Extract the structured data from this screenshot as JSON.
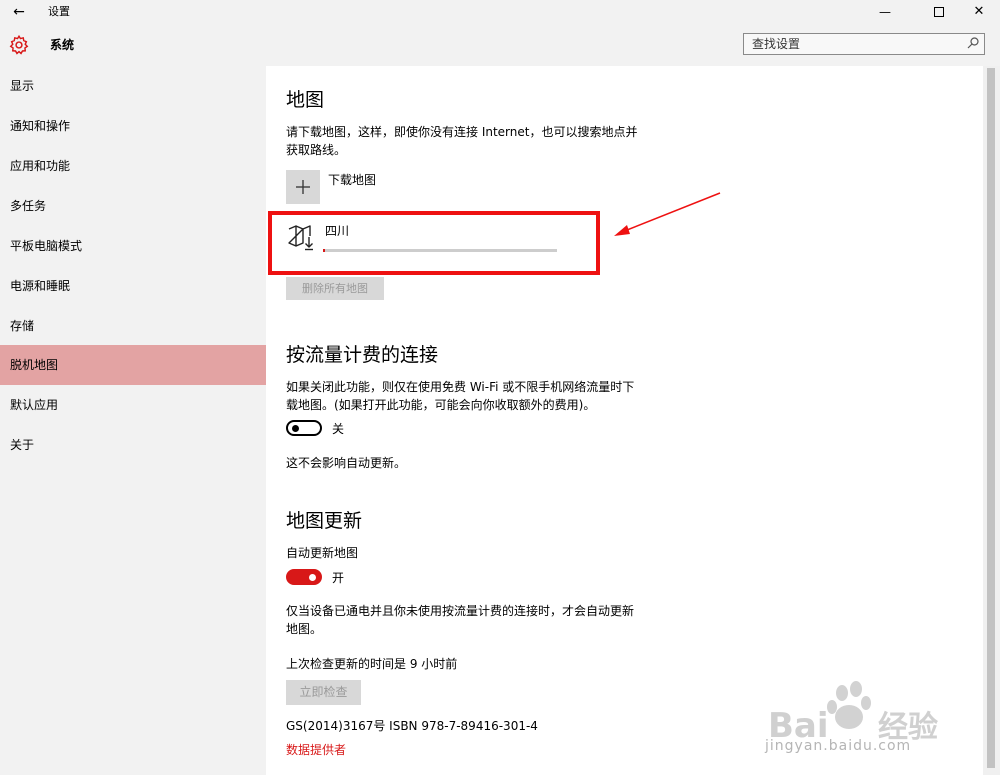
{
  "window": {
    "title": "设置",
    "back_icon": "←",
    "minimize_icon": "—",
    "close_icon": "✕"
  },
  "header": {
    "section_title": "系统",
    "search_placeholder": "查找设置"
  },
  "sidebar": {
    "items": [
      {
        "label": "显示"
      },
      {
        "label": "通知和操作"
      },
      {
        "label": "应用和功能"
      },
      {
        "label": "多任务"
      },
      {
        "label": "平板电脑模式"
      },
      {
        "label": "电源和睡眠"
      },
      {
        "label": "存储"
      },
      {
        "label": "脱机地图",
        "active": true
      },
      {
        "label": "默认应用"
      },
      {
        "label": "关于"
      }
    ]
  },
  "maps": {
    "heading": "地图",
    "description_line1": "请下载地图，这样，即使你没有连接 Internet，也可以搜索地点并",
    "description_line2": "获取路线。",
    "add_label": "下载地图",
    "download_item_name": "四川",
    "download_progress": 0.01,
    "delete_all_label": "删除所有地图"
  },
  "metered": {
    "heading": "按流量计费的连接",
    "description_line1": "如果关闭此功能，则仅在使用免费 Wi-Fi 或不限手机网络流量时下",
    "description_line2": "载地图。(如果打开此功能，可能会向你收取额外的费用)。",
    "toggle_state": "关",
    "note": "这不会影响自动更新。"
  },
  "updates": {
    "heading": "地图更新",
    "auto_label": "自动更新地图",
    "toggle_state": "开",
    "description_line1": "仅当设备已通电并且你未使用按流量计费的连接时，才会自动更新",
    "description_line2": "地图。",
    "last_checked": "上次检查更新的时间是 9 小时前",
    "check_now_label": "立即检查",
    "copyright": "GS(2014)3167号 ISBN 978-7-89416-301-4",
    "data_provider_link": "数据提供者"
  },
  "watermark": {
    "brand": "Bai 经验",
    "url": "jingyan.baidu.com"
  },
  "colors": {
    "accent": "#d81818",
    "sidebar_bg": "#f2f2f2",
    "active_item_bg": "#e3a3a3",
    "annotation_red": "#ee1111"
  }
}
